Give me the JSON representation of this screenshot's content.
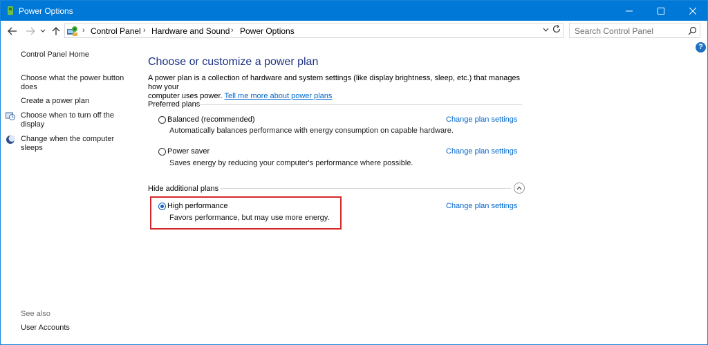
{
  "window": {
    "title": "Power Options"
  },
  "address": {
    "crumbs": [
      "Control Panel",
      "Hardware and Sound",
      "Power Options"
    ],
    "search_placeholder": "Search Control Panel"
  },
  "help_label": "?",
  "left_nav": {
    "home": "Control Panel Home",
    "items": [
      {
        "label_1": "Choose what the power button",
        "label_2": "does"
      },
      {
        "label_1": "Create a power plan"
      },
      {
        "label_1": "Choose when to turn off the",
        "label_2": "display"
      },
      {
        "label_1": "Change when the computer",
        "label_2": "sleeps"
      }
    ],
    "see_also": "See also",
    "user_accounts": "User Accounts"
  },
  "main": {
    "heading": "Choose or customize a power plan",
    "desc_line1": "A power plan is a collection of hardware and system settings (like display brightness, sleep, etc.) that manages how your",
    "desc_line2": "computer uses power.",
    "desc_link": "Tell me more about power plans",
    "preferred_label": "Preferred plans",
    "hidden_label": "Hide additional plans",
    "change_label": "Change plan settings",
    "plans": [
      {
        "name": "Balanced (recommended)",
        "desc": "Automatically balances performance with energy consumption on capable hardware.",
        "selected": false
      },
      {
        "name": "Power saver",
        "desc": "Saves energy by reducing your computer's performance where possible.",
        "selected": false
      },
      {
        "name": "High performance",
        "desc": "Favors performance, but may use more energy.",
        "selected": true
      }
    ]
  },
  "colors": {
    "titlebar": "#0078d7",
    "heading": "#1e3287",
    "link": "#0066cc",
    "highlight": "#d4272a"
  }
}
